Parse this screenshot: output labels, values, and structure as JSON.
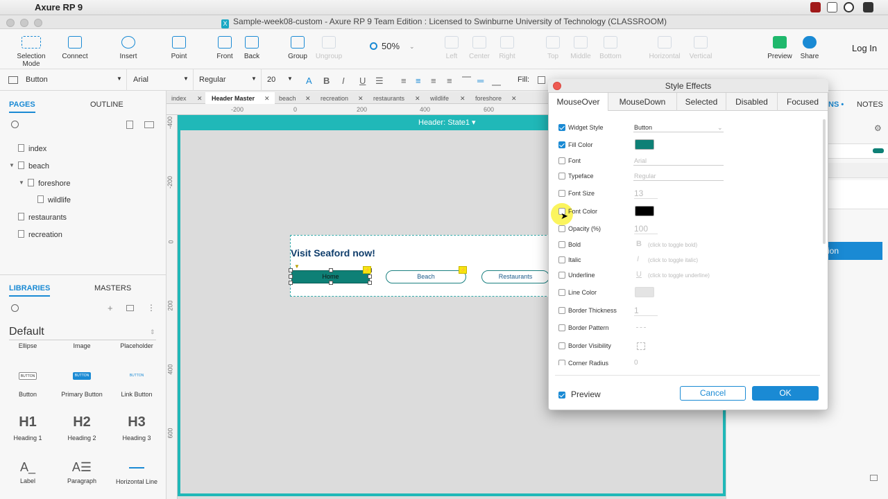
{
  "menubar": {
    "app_name": "Axure RP 9"
  },
  "window": {
    "title": "Sample-week08-custom - Axure RP 9 Team Edition : Licensed to Swinburne University of Technology (CLASSROOM)"
  },
  "toolbar": {
    "selection_mode": "Selection Mode",
    "connect": "Connect",
    "insert": "Insert",
    "point": "Point",
    "front": "Front",
    "back": "Back",
    "group": "Group",
    "ungroup": "Ungroup",
    "zoom": "50%",
    "left": "Left",
    "center": "Center",
    "right": "Right",
    "top": "Top",
    "middle": "Middle",
    "bottom": "Bottom",
    "horizontal": "Horizontal",
    "vertical": "Vertical",
    "preview": "Preview",
    "share": "Share",
    "login": "Log In"
  },
  "stylebar": {
    "widget_type": "Button",
    "font": "Arial",
    "weight": "Regular",
    "size": "20",
    "fill_label": "Fill:"
  },
  "left_panel": {
    "pages_tab": "PAGES",
    "outline_tab": "OUTLINE",
    "pages": [
      "index",
      "beach",
      "foreshore",
      "wildlife",
      "restaurants",
      "recreation"
    ],
    "libraries_tab": "LIBRARIES",
    "masters_tab": "MASTERS",
    "library_name": "Default",
    "library_items": [
      "Ellipse",
      "Image",
      "Placeholder",
      "Button",
      "Primary Button",
      "Link Button",
      "Heading 1",
      "Heading 2",
      "Heading 3",
      "Label",
      "Paragraph",
      "Horizontal Line"
    ],
    "button_thumb": "BUTTON",
    "h1": "H1",
    "h2": "H2",
    "h3": "H3"
  },
  "doc_tabs": [
    "index",
    "Header Master",
    "beach",
    "recreation",
    "restaurants",
    "wildlife",
    "foreshore"
  ],
  "rulers": {
    "h": [
      "-200",
      "0",
      "200",
      "400",
      "600"
    ],
    "v": [
      "-400",
      "-200",
      "0",
      "200",
      "400",
      "600"
    ]
  },
  "canvas": {
    "state_label": "Header:  State1",
    "visit_text": "Visit Seaford now!",
    "buttons": [
      "Home",
      "Beach",
      "Restaurants"
    ],
    "bolt": "⚡"
  },
  "right_panel": {
    "tab_partial": "NS",
    "notes_tab": "NOTES",
    "button_partial": "ion"
  },
  "dialog": {
    "title": "Style Effects",
    "tabs": [
      "MouseOver",
      "MouseDown",
      "Selected",
      "Disabled",
      "Focused"
    ],
    "rows": [
      {
        "label": "Widget Style",
        "checked": true,
        "value": "Button"
      },
      {
        "label": "Fill Color",
        "checked": true,
        "value": ""
      },
      {
        "label": "Font",
        "checked": false,
        "value": "Arial"
      },
      {
        "label": "Typeface",
        "checked": false,
        "value": "Regular"
      },
      {
        "label": "Font Size",
        "checked": false,
        "value": "13"
      },
      {
        "label": "Font Color",
        "checked": false,
        "value": ""
      },
      {
        "label": "Opacity (%)",
        "checked": false,
        "value": "100"
      },
      {
        "label": "Bold",
        "checked": false,
        "value": "(click to toggle bold)"
      },
      {
        "label": "Italic",
        "checked": false,
        "value": "(click to toggle italic)"
      },
      {
        "label": "Underline",
        "checked": false,
        "value": "(click to toggle underline)"
      },
      {
        "label": "Line Color",
        "checked": false,
        "value": ""
      },
      {
        "label": "Border Thickness",
        "checked": false,
        "value": "1"
      },
      {
        "label": "Border Pattern",
        "checked": false,
        "value": ""
      },
      {
        "label": "Border Visibility",
        "checked": false,
        "value": ""
      },
      {
        "label": "Corner Radius",
        "checked": false,
        "value": "0"
      }
    ],
    "preview_label": "Preview",
    "cancel": "Cancel",
    "ok": "OK"
  },
  "colors": {
    "accent": "#1a8ad4",
    "teal": "#20b8b8",
    "fill_swatch": "#0e8076",
    "font_swatch": "#000000"
  }
}
